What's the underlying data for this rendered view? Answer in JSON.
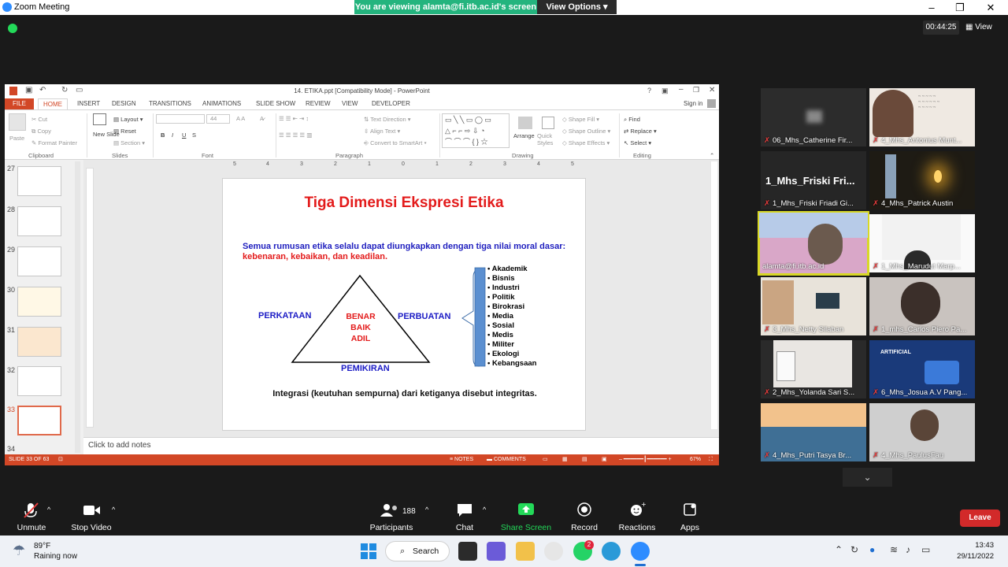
{
  "zoom": {
    "window_title": "Zoom Meeting",
    "viewing_banner": "You are viewing alamta@fi.itb.ac.id's screen",
    "view_options": "View Options",
    "timer": "00:44:25",
    "view_label": "View"
  },
  "ppt": {
    "title": "14. ETIKA.ppt [Compatibility Mode] - PowerPoint",
    "signin": "Sign in",
    "tabs": [
      "FILE",
      "HOME",
      "INSERT",
      "DESIGN",
      "TRANSITIONS",
      "ANIMATIONS",
      "SLIDE SHOW",
      "REVIEW",
      "VIEW",
      "DEVELOPER"
    ],
    "ribbon": {
      "paste": "Paste",
      "cut": "Cut",
      "copy": "Copy",
      "format_painter": "Format Painter",
      "clipboard": "Clipboard",
      "new_slide": "New Slide",
      "layout": "Layout",
      "reset": "Reset",
      "section": "Section",
      "slides": "Slides",
      "font_size": "44",
      "font": "Font",
      "text_direction": "Text Direction",
      "align_text": "Align Text",
      "convert_smartart": "Convert to SmartArt",
      "paragraph": "Paragraph",
      "arrange": "Arrange",
      "quick_styles": "Quick Styles",
      "shape_fill": "Shape Fill",
      "shape_outline": "Shape Outline",
      "shape_effects": "Shape Effects",
      "drawing": "Drawing",
      "find": "Find",
      "replace": "Replace",
      "select": "Select",
      "editing": "Editing",
      "bold": "B",
      "italic": "I",
      "underline": "U",
      "strike": "S"
    },
    "thumbnails": [
      "27",
      "28",
      "29",
      "30",
      "31",
      "32",
      "33",
      "34"
    ],
    "notes_placeholder": "Click to add notes",
    "status": {
      "slide_of": "SLIDE 33 OF 63",
      "notes": "NOTES",
      "comments": "COMMENTS",
      "zoom": "67%"
    },
    "ruler_labels": [
      "5",
      "4",
      "3",
      "2",
      "1",
      "0",
      "1",
      "2",
      "3",
      "4",
      "5"
    ],
    "slide": {
      "title": "Tiga Dimensi Ekspresi Etika",
      "intro_blue": "Semua rumusan etika selalu dapat diungkapkan dengan tiga nilai moral dasar:",
      "intro_red": "kebenaran, kebaikan, dan keadilan.",
      "left": "PERKATAAN",
      "right": "PERBUATAN",
      "bottom": "PEMIKIRAN",
      "inner": [
        "BENAR",
        "BAIK",
        "ADIL"
      ],
      "domains": [
        "Akademik",
        "Bisnis",
        "Industri",
        "Politik",
        "Birokrasi",
        "Media",
        "Sosial",
        "Medis",
        "Militer",
        "Ekologi",
        "Kebangsaan"
      ],
      "footer": "Integrasi (keutuhan sempurna) dari ketiganya disebut integritas."
    }
  },
  "participants": [
    {
      "name": "06_Mhs_Catherine Fir...",
      "muted": true
    },
    {
      "name": "4_Mhs_Antonius Munt...",
      "muted": true
    },
    {
      "name": "1_Mhs_Friski Friadi Gi...",
      "muted": true,
      "big": "1_Mhs_Friski  Fri..."
    },
    {
      "name": "4_Mhs_Patrick Austin",
      "muted": true
    },
    {
      "name": "alamta@fi.itb.ac.id",
      "muted": false
    },
    {
      "name": "1_Mhs_Marudut Marp...",
      "muted": true
    },
    {
      "name": "3_Mhs_Netty Silaban",
      "muted": true
    },
    {
      "name": "1_mhs_Carlos Piero Pa...",
      "muted": true
    },
    {
      "name": "2_Mhs_Yolanda Sari S...",
      "muted": true
    },
    {
      "name": "6_Mhs_Josua A.V Pang...",
      "muted": true
    },
    {
      "name": "4_Mhs_Putri Tasya Br...",
      "muted": true
    },
    {
      "name": "4_Mhs_PaulusFau",
      "muted": true
    }
  ],
  "toolbar": {
    "unmute": "Unmute",
    "stop_video": "Stop Video",
    "participants": "Participants",
    "participants_count": "188",
    "chat": "Chat",
    "share": "Share Screen",
    "record": "Record",
    "reactions": "Reactions",
    "apps": "Apps",
    "leave": "Leave"
  },
  "taskbar": {
    "temp": "89°F",
    "weather": "Raining now",
    "search": "Search",
    "time": "13:43",
    "date": "29/11/2022",
    "whatsapp_badge": "2"
  }
}
